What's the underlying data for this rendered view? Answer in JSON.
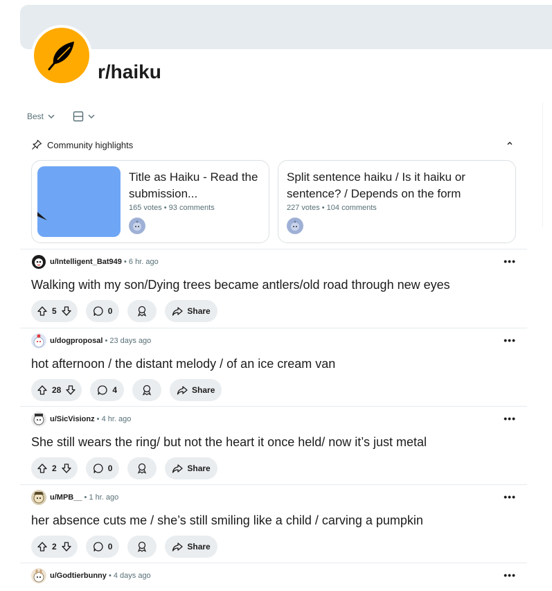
{
  "subreddit": {
    "name": "r/haiku"
  },
  "sort": {
    "label": "Best"
  },
  "highlights": {
    "header": "Community highlights",
    "cards": [
      {
        "title": "Title as Haiku - Read the submission...",
        "meta": "165 votes • 93 comments"
      },
      {
        "title": "Split sentence haiku / Is it haiku or sentence? / Depends on the form",
        "meta": "227 votes • 104 comments"
      }
    ]
  },
  "posts": [
    {
      "user": "u/Intelligent_Bat949",
      "time": "• 6 hr. ago",
      "title": "Walking with my son/Dying trees became antlers/old road through new eyes",
      "votes": "5",
      "comments": "0",
      "share": "Share"
    },
    {
      "user": "u/dogproposal",
      "time": "• 23 days ago",
      "title": "hot afternoon / the distant melody / of an ice cream van",
      "votes": "28",
      "comments": "4",
      "share": "Share"
    },
    {
      "user": "u/SicVisionz",
      "time": "• 4 hr. ago",
      "title": "She still wears the ring/ but not the heart it once held/ now it’s just metal",
      "votes": "2",
      "comments": "0",
      "share": "Share"
    },
    {
      "user": "u/MPB__",
      "time": "• 1 hr. ago",
      "title": "her absence cuts me / she’s still smiling like a child / carving a pumpkin",
      "votes": "2",
      "comments": "0",
      "share": "Share"
    },
    {
      "user": "u/Godtierbunny",
      "time": "• 4 days ago"
    }
  ],
  "colors": {
    "accent": "#ffaa00",
    "banner": "#e5ebee",
    "pill": "#eaedef",
    "thumb": "#6ea6f5"
  }
}
